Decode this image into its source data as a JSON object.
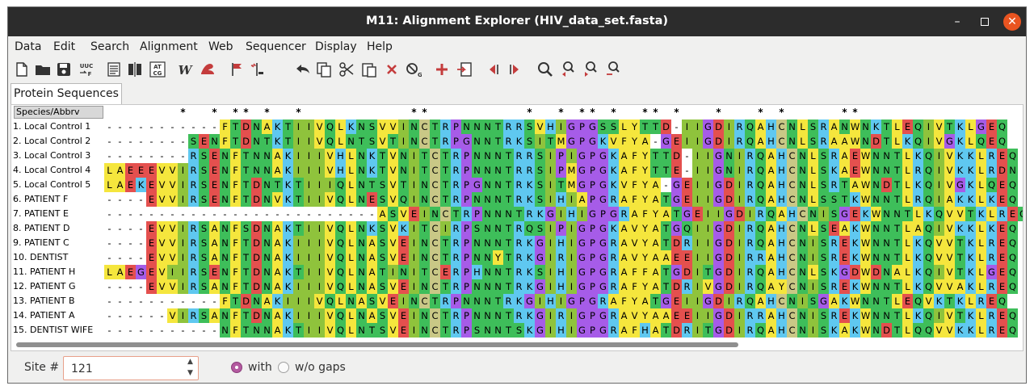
{
  "window": {
    "title": "M11: Alignment Explorer (HIV_data_set.fasta)"
  },
  "menu": [
    "Data",
    "Edit",
    "Search",
    "Alignment",
    "Web",
    "Sequencer",
    "Display",
    "Help"
  ],
  "toolbar": {
    "icons": [
      "new-file-icon",
      "open-folder-icon",
      "save-icon",
      "uuc-translate-icon",
      "text-view-icon",
      "align-columns-icon",
      "at-cg-translate-icon",
      "web-w-icon",
      "muscle-arm-icon",
      "flag-icon",
      "insert-cursor-icon",
      "undo-icon",
      "copy-icon",
      "cut-icon",
      "paste-icon",
      "delete-icon",
      "delete-gap-icon",
      "add-icon",
      "import-icon",
      "move-left-icon",
      "move-right-icon",
      "search-icon",
      "find-previous-icon",
      "find-next-icon",
      "find-motif-icon"
    ],
    "labels": {
      "uuc": "UUC",
      "f": "F",
      "at": "AT",
      "cg": "CG",
      "w": "W"
    }
  },
  "tab": {
    "label": "Protein Sequences"
  },
  "alignment": {
    "header": "Species/Abbrv",
    "consensus": "       *  * ** *  *          **         *  * ** *  ** *   *   * *     **  ",
    "rows": [
      {
        "name": "1. Local Control 1",
        "seq": "-----------FTDNAKTIIVQLKNSVVINCTRPNNNTRRSVHIGPGSSLYTTD-IIGDIRQAHCNLSRANWNKTLEQIVTKLGEQ"
      },
      {
        "name": "2. Local Control 2",
        "seq": "--------SENFTDNTKTIIVQLNTSVTINCTRPGNNTRKSITMGPGKVFYA-GEIIGDIRQAHCNLSRAAWNDTLKQIVGKLQEQ"
      },
      {
        "name": "3. Local Control 3",
        "seq": "--------RSENFTNNAKIIIVHLNKTVNITCTRPNNNTRRSIPIGPGKAFYTTD-IIGNIRQAHCNLSRAEWNNTLKQIVKKLREQ"
      },
      {
        "name": "4. Local Control 4",
        "seq": "LAEEEVVIRSENFTNNAKIIIVHLNKTVNITCTRPNNNTRRSIPMGPGKAFYTTE-IIGNIRQAHCNLSKAEWNNTLRQIVKKLRDN"
      },
      {
        "name": "5. Local Control 5",
        "seq": "LAEKEVVIRSENFTDNTKTIIIQLNTSVTINCTRPGNNTRKSITMGPGKVFYA-GEIIGDIRQAHCNLSRTAWNDTLKQIVGKLQEQ"
      },
      {
        "name": "6. PATIENT F",
        "seq": "----EVVIRSENFTDNVKTIIVQLNESVQINCTRPNNNTRKSIHIAPGRAFYATGEIIGDIRQAHCNLSSTKWNNTLRQIAKKLKEQ"
      },
      {
        "name": "7. PATIENT E",
        "seq": "--------------------------ASVEINCTRPNNNTRKGIHIGPGRAFYATGEIIGDIRQAHCNISGEKWNNTLKQVVTKLREQ"
      },
      {
        "name": "8. PATIENT D",
        "seq": "----EVVIRSANFSDNAKTIIVQLNKSVKITCIRPSNNTRQSIPIGPGKAVYATGQIIGDIRQAHCNLSEAKWNNTLAQIVKKLKEQ"
      },
      {
        "name": "9. PATIENT C",
        "seq": "----EVVIRSANFTDNAKIIIVQLNASVEINCTRPNNNTRKGIHIGPGRAVYATDRIIGDIRQAHCNISREKWNNTLKQVVTKLREQ"
      },
      {
        "name": "10. DENTIST",
        "seq": "----EVVIRSANFTDNAKIIIVQLNASVEINCTRPNNYTRKGIRIGPGRAVYAAEEIIGDIRRAHCNISREKWNNTLKQVVTKLREQ"
      },
      {
        "name": "11. PATIENT H",
        "seq": "LAEGEVIIRSENFTDNAKTIIVQLNATINITCERPHNNTRKSIHIGPGRAFFATGDITGDIRQAHCNLSKGDWDNALKQIVTKLGEQ"
      },
      {
        "name": "12. PATIENT G",
        "seq": "----EVVIRSANFTDNAKIIIVQLNASVEINCTRPNNNTRKGIHIGPGRAFYATDRIVGDIRQAYCNISREKWNNTLKQVVAKLREQ"
      },
      {
        "name": "13. PATIENT B",
        "seq": "-----------FTDNAKIIIVQLNASVEINCTRPNNNTRKGIHIGPGRAFYATGEIIGDIRQAHCNISGAKWNNTLEQVKTKLREQ"
      },
      {
        "name": "14. PATIENT A",
        "seq": "------VIRSANFTDNAKIIIVQLNASVEINCTRPNNNTRKGIRIGPGRAVYAAEEIIGDIRRAHCNISREKWNNTLKQIVTKLREQ"
      },
      {
        "name": "15. DENTIST WIFE",
        "seq": "-----------NFTNNAKTIIVQLNTSVEINCTRPSNNTSKGIHIGPGRAFHATDRITGDIRQAHCNISKAKWNDTLQQVVKKLREQ"
      }
    ]
  },
  "colors": {
    "A": "#f5e63d",
    "L": "#f5e63d",
    "V": "#f5e63d",
    "F": "#f5e63d",
    "M": "#f5e63d",
    "Y": "#f5e63d",
    "W": "#f5e63d",
    "I": "#8fc33c",
    "N": "#3ebe5a",
    "Q": "#3ebe5a",
    "S": "#3ebe5a",
    "T": "#3ebe5a",
    "D": "#e4504e",
    "E": "#e4504e",
    "K": "#5fc8f0",
    "R": "#5fc8f0",
    "H": "#5fc8f0",
    "G": "#a65ce8",
    "P": "#a65ce8",
    "C": "#c9c886",
    "-": "#ffffff"
  },
  "status": {
    "site_label": "Site #",
    "site_value": "121",
    "radio_with": "with",
    "radio_without": "w/o gaps"
  }
}
